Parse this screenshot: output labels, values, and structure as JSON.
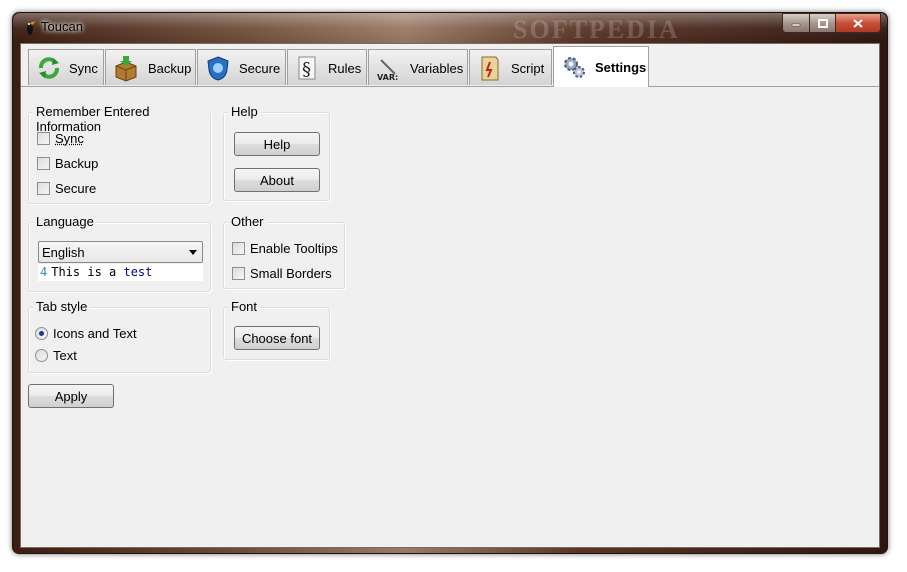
{
  "window": {
    "title": "Toucan",
    "watermark": "SOFTPEDIA"
  },
  "tabs": [
    {
      "label": "Sync",
      "icon": "sync-icon"
    },
    {
      "label": "Backup",
      "icon": "backup-box-icon"
    },
    {
      "label": "Secure",
      "icon": "shield-icon"
    },
    {
      "label": "Rules",
      "icon": "section-sign-icon"
    },
    {
      "label": "Variables",
      "icon": "variables-icon"
    },
    {
      "label": "Script",
      "icon": "script-icon"
    },
    {
      "label": "Settings",
      "icon": "gears-icon",
      "active": true
    }
  ],
  "remember": {
    "title": "Remember Entered Information",
    "options": [
      {
        "label": "Sync",
        "checked": false
      },
      {
        "label": "Backup",
        "checked": false
      },
      {
        "label": "Secure",
        "checked": false
      }
    ]
  },
  "help": {
    "title": "Help",
    "help_button": "Help",
    "about_button": "About"
  },
  "language": {
    "title": "Language",
    "selected": "English",
    "preview_line_number": "4",
    "preview_text": "This is a ",
    "preview_keyword": "test"
  },
  "other": {
    "title": "Other",
    "options": [
      {
        "label": "Enable Tooltips",
        "checked": false
      },
      {
        "label": "Small Borders",
        "checked": false
      }
    ]
  },
  "tab_style": {
    "title": "Tab style",
    "options": [
      {
        "label": "Icons and Text",
        "selected": true
      },
      {
        "label": "Text",
        "selected": false
      }
    ]
  },
  "font": {
    "title": "Font",
    "button": "Choose font"
  },
  "apply_button": "Apply"
}
